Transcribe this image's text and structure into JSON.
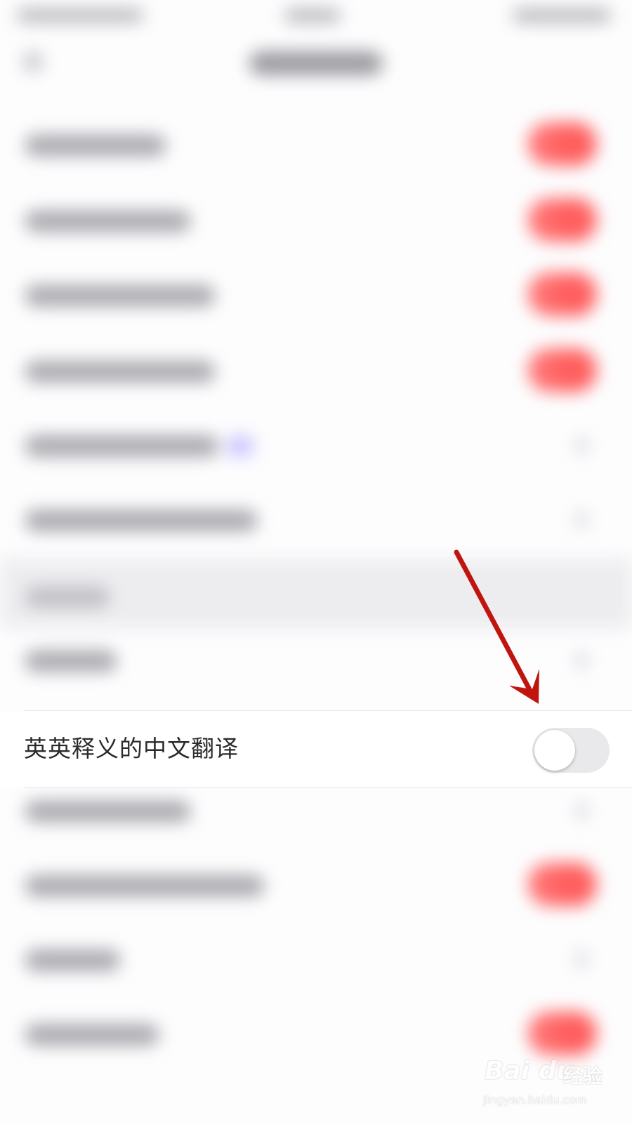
{
  "settings_row": {
    "label": "英英释义的中文翻译",
    "toggle_on": false
  },
  "annotation": {
    "color": "#c0150f"
  },
  "watermark": {
    "logo": "Bai  du",
    "cn": "经验",
    "url": "jingyan.baidu.com"
  },
  "colors": {
    "toggle_off_track": "#e9e9eb",
    "toggle_on_track": "#ff6b6b",
    "arrow": "#c0150f"
  }
}
